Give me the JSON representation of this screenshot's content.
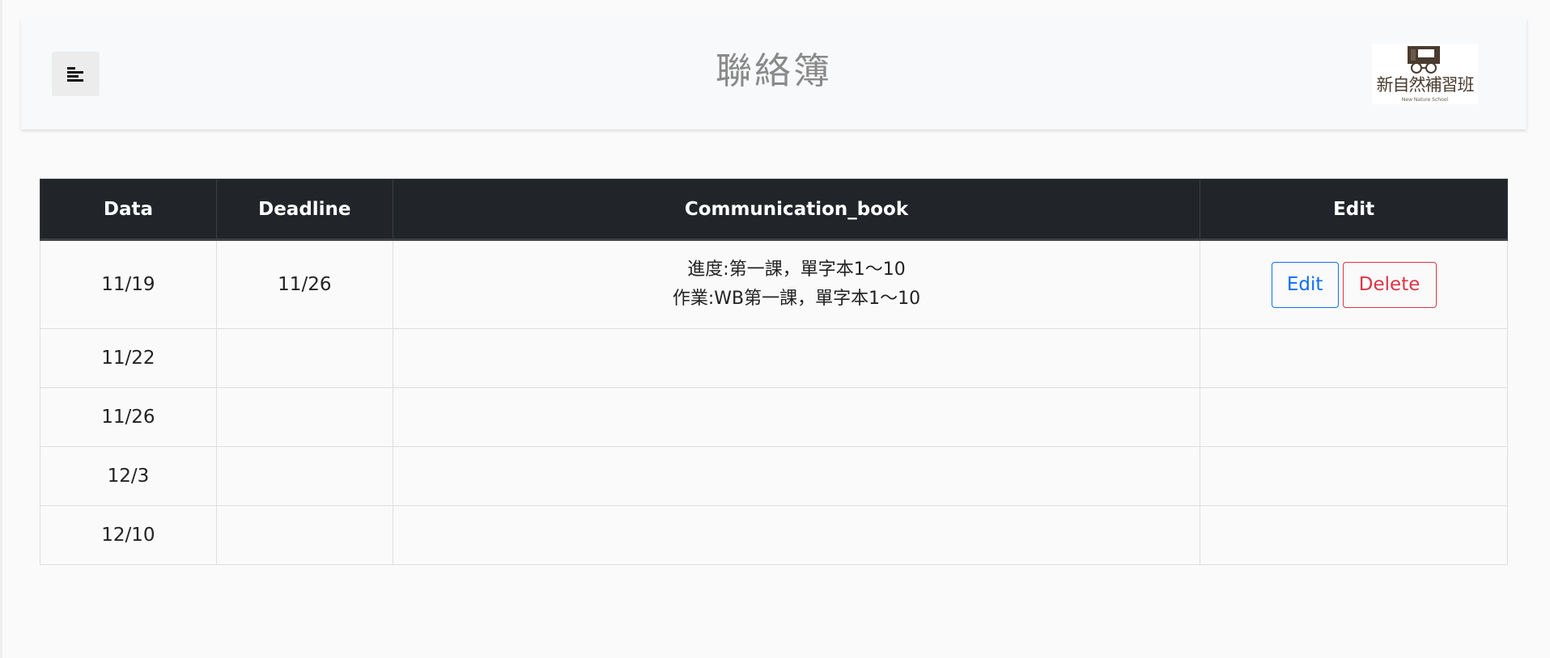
{
  "header": {
    "title": "聯絡簿",
    "menu_icon": "align-left-icon",
    "logo": {
      "name": "新自然補習班",
      "subtitle": "New Nature School"
    }
  },
  "table": {
    "columns": [
      "Data",
      "Deadline",
      "Communication_book",
      "Edit"
    ],
    "rows": [
      {
        "data": "11/19",
        "deadline": "11/26",
        "book_line1": "進度:第一課，單字本1～10",
        "book_line2": "作業:WB第一課，單字本1～10",
        "edit_label": "Edit",
        "delete_label": "Delete"
      },
      {
        "data": "11/22",
        "deadline": "",
        "book_line1": "",
        "book_line2": ""
      },
      {
        "data": "11/26",
        "deadline": "",
        "book_line1": "",
        "book_line2": ""
      },
      {
        "data": "12/3",
        "deadline": "",
        "book_line1": "",
        "book_line2": ""
      },
      {
        "data": "12/10",
        "deadline": "",
        "book_line1": "",
        "book_line2": ""
      }
    ]
  },
  "colors": {
    "header_bg": "#212529",
    "edit_button": "#0d6efd",
    "delete_button": "#dc3545"
  }
}
